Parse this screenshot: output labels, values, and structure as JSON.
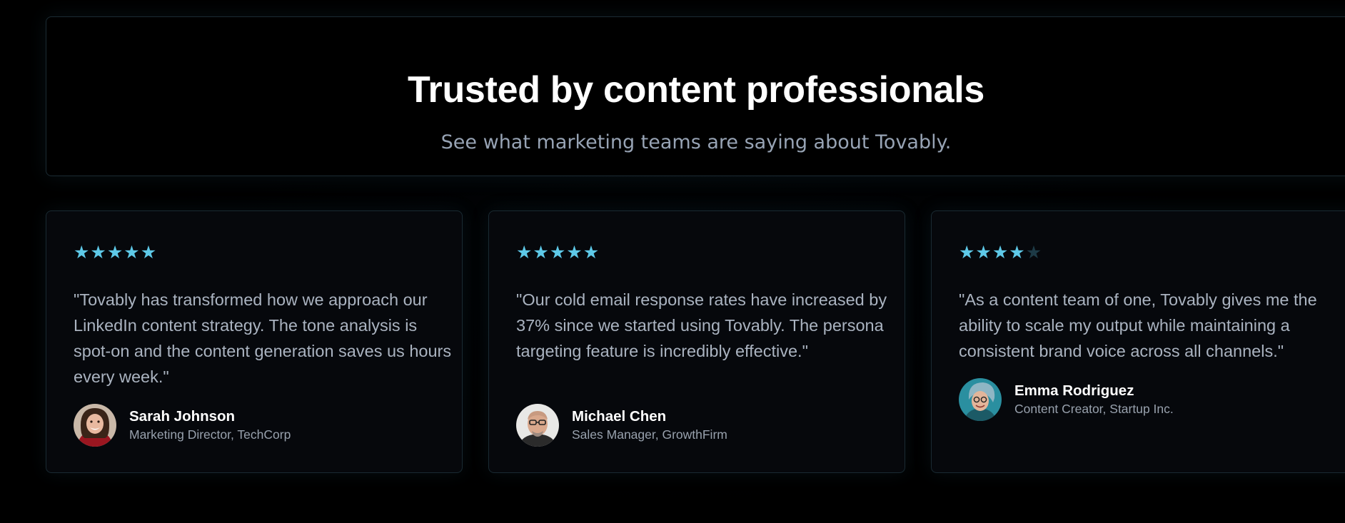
{
  "header": {
    "title": "Trusted by content professionals",
    "subtitle": "See what marketing teams are saying about Tovably."
  },
  "colors": {
    "background": "#000000",
    "card_background": "#06080c",
    "card_border": "#1a2a32",
    "star_filled": "#5ec9e8",
    "star_empty": "#1d3a46",
    "quote_text": "#aab3c0",
    "subtitle_text": "#97a3b4"
  },
  "testimonials": [
    {
      "rating": 5,
      "rating_max": 5,
      "quote": "\"Tovably has transformed how we approach our LinkedIn content strategy. The tone analysis is spot-on and the content generation saves us hours every week.\"",
      "name": "Sarah Johnson",
      "role": "Marketing Director, TechCorp",
      "avatar_icon": "avatar-photo-woman-smiling"
    },
    {
      "rating": 5,
      "rating_max": 5,
      "quote": "\"Our cold email response rates have increased by 37% since we started using Tovably. The persona targeting feature is incredibly effective.\"",
      "name": "Michael Chen",
      "role": "Sales Manager, GrowthFirm",
      "avatar_icon": "avatar-photo-man-glasses"
    },
    {
      "rating": 4,
      "rating_max": 5,
      "quote": "\"As a content team of one, Tovably gives me the ability to scale my output while maintaining a consistent brand voice across all channels.\"",
      "name": "Emma Rodriguez",
      "role": "Content Creator, Startup Inc.",
      "avatar_icon": "avatar-photo-woman-beanie"
    }
  ]
}
